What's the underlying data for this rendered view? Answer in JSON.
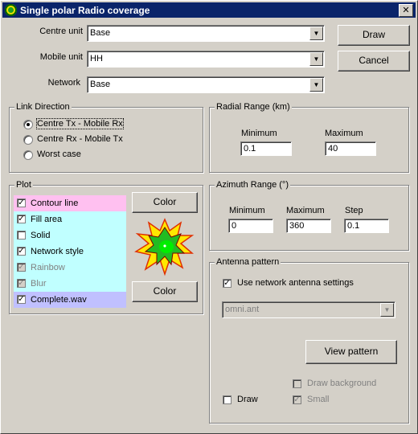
{
  "window": {
    "title": "Single polar Radio coverage",
    "close_label": "✕"
  },
  "centre_unit": {
    "label": "Centre unit",
    "value": "Base"
  },
  "mobile_unit": {
    "label": "Mobile unit",
    "value": "HH"
  },
  "network": {
    "label": "Network",
    "value": "Base"
  },
  "buttons": {
    "draw": "Draw",
    "cancel": "Cancel",
    "color_top": "Color",
    "color_bottom": "Color",
    "view_pattern": "View pattern"
  },
  "link_direction": {
    "title": "Link Direction",
    "options": [
      "Centre Tx - Mobile Rx",
      "Centre Rx - Mobile Tx",
      "Worst case"
    ],
    "selected": 0
  },
  "radial_range": {
    "title": "Radial Range (km)",
    "min_label": "Minimum",
    "max_label": "Maximum",
    "min": "0.1",
    "max": "40"
  },
  "azimuth_range": {
    "title": "Azimuth Range (°)",
    "min_label": "Minimum",
    "max_label": "Maximum",
    "step_label": "Step",
    "min": "0",
    "max": "360",
    "step": "0.1"
  },
  "plot": {
    "title": "Plot",
    "items": [
      {
        "label": "Contour line",
        "checked": true,
        "enabled": true,
        "bg": "#ffc0f0"
      },
      {
        "label": "Fill area",
        "checked": true,
        "enabled": true,
        "bg": "#c0ffff"
      },
      {
        "label": "Solid",
        "checked": false,
        "enabled": true,
        "bg": "#c0ffff"
      },
      {
        "label": "Network style",
        "checked": true,
        "enabled": true,
        "bg": "#c0ffff"
      },
      {
        "label": "Rainbow",
        "checked": true,
        "enabled": false,
        "bg": "#c0ffff"
      },
      {
        "label": "Blur",
        "checked": true,
        "enabled": false,
        "bg": "#c0ffff"
      },
      {
        "label": "Complete.wav",
        "checked": true,
        "enabled": true,
        "bg": "#c0c0ff"
      }
    ]
  },
  "antenna": {
    "title": "Antenna pattern",
    "use_network": {
      "label": "Use network antenna settings",
      "checked": true
    },
    "file": "omni.ant",
    "draw_background": {
      "label": "Draw background",
      "checked": false
    },
    "small": {
      "label": "Small",
      "checked": true
    },
    "draw": {
      "label": "Draw",
      "checked": false
    }
  },
  "check_mark": "✓"
}
